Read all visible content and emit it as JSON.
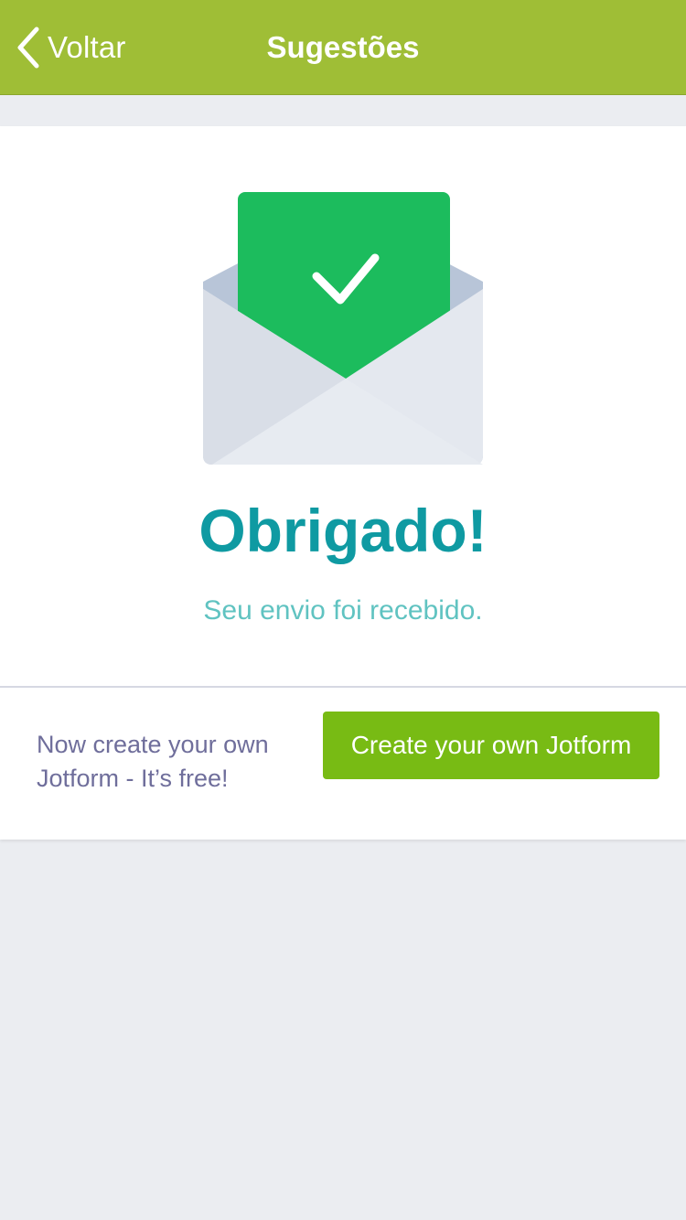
{
  "navbar": {
    "back_label": "Voltar",
    "title": "Sugestões",
    "background_color": "#9fbe36",
    "back_icon": "chevron-left-icon"
  },
  "confirmation": {
    "illustration": "envelope-checkmark-icon",
    "title": "Obrigado!",
    "subtitle": "Seu envio foi recebido.",
    "title_color": "#0f9aa2",
    "subtitle_color": "#60c3c1"
  },
  "promo": {
    "text_line1": "Now create your own",
    "text_line2": "Jotform - It’s free!",
    "cta_label": "Create your own Jotform",
    "cta_color": "#78bb14"
  }
}
